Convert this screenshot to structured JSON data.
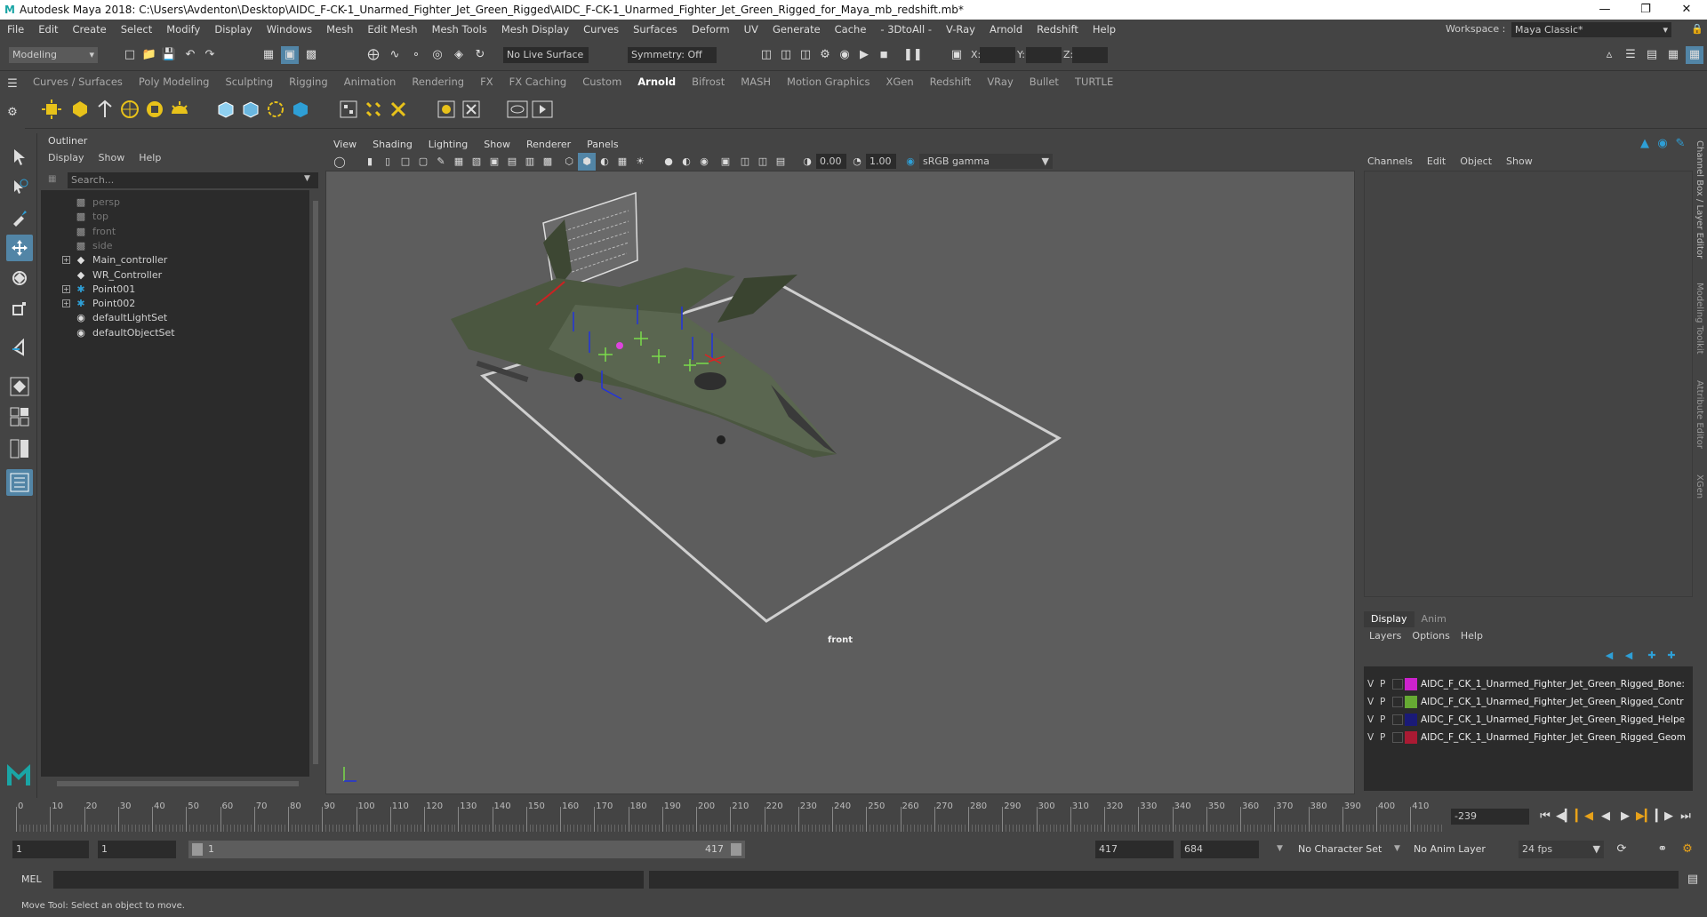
{
  "window": {
    "title": "Autodesk Maya 2018: C:\\Users\\Avdenton\\Desktop\\AIDC_F-CK-1_Unarmed_Fighter_Jet_Green_Rigged\\AIDC_F-CK-1_Unarmed_Fighter_Jet_Green_Rigged_for_Maya_mb_redshift.mb*"
  },
  "menubar": [
    "File",
    "Edit",
    "Create",
    "Select",
    "Modify",
    "Display",
    "Windows",
    "Mesh",
    "Edit Mesh",
    "Mesh Tools",
    "Mesh Display",
    "Curves",
    "Surfaces",
    "Deform",
    "UV",
    "Generate",
    "Cache",
    "- 3DtoAll -",
    "V-Ray",
    "Arnold",
    "Redshift",
    "Help"
  ],
  "workspace": {
    "label": "Workspace :",
    "value": "Maya Classic*"
  },
  "statusline": {
    "mode": "Modeling",
    "live_surface": "No Live Surface",
    "symmetry": "Symmetry: Off",
    "x_label": "X:",
    "y_label": "Y:",
    "z_label": "Z:"
  },
  "shelf_tabs": [
    "Curves / Surfaces",
    "Poly Modeling",
    "Sculpting",
    "Rigging",
    "Animation",
    "Rendering",
    "FX",
    "FX Caching",
    "Custom",
    "Arnold",
    "Bifrost",
    "MASH",
    "Motion Graphics",
    "XGen",
    "Redshift",
    "VRay",
    "Bullet",
    "TURTLE"
  ],
  "shelf_active": "Arnold",
  "outliner": {
    "title": "Outliner",
    "menu": [
      "Display",
      "Show",
      "Help"
    ],
    "search_placeholder": "Search...",
    "items": [
      {
        "label": "persp",
        "icon": "camera-icon",
        "dim": true,
        "expand": false
      },
      {
        "label": "top",
        "icon": "camera-icon",
        "dim": true,
        "expand": false
      },
      {
        "label": "front",
        "icon": "camera-icon",
        "dim": true,
        "expand": false
      },
      {
        "label": "side",
        "icon": "camera-icon",
        "dim": true,
        "expand": false
      },
      {
        "label": "Main_controller",
        "icon": "controller-icon",
        "dim": false,
        "expand": true
      },
      {
        "label": "WR_Controller",
        "icon": "controller-icon",
        "dim": false,
        "expand": false
      },
      {
        "label": "Point001",
        "icon": "locator-icon",
        "dim": false,
        "expand": true
      },
      {
        "label": "Point002",
        "icon": "locator-icon",
        "dim": false,
        "expand": true
      },
      {
        "label": "defaultLightSet",
        "icon": "set-icon",
        "dim": false,
        "expand": false
      },
      {
        "label": "defaultObjectSet",
        "icon": "set-icon",
        "dim": false,
        "expand": false
      }
    ]
  },
  "viewport": {
    "menu": [
      "View",
      "Shading",
      "Lighting",
      "Show",
      "Renderer",
      "Panels"
    ],
    "exposure": "0.00",
    "gamma": "1.00",
    "color_space": "sRGB gamma",
    "camera_label": "front"
  },
  "channelbox": {
    "menu": [
      "Channels",
      "Edit",
      "Object",
      "Show"
    ],
    "layer_tabs": [
      "Display",
      "Anim"
    ],
    "layer_menu": [
      "Layers",
      "Options",
      "Help"
    ],
    "layers": [
      {
        "v": "V",
        "p": "P",
        "color": "#cc22cc",
        "name": "AIDC_F_CK_1_Unarmed_Fighter_Jet_Green_Rigged_Bone:"
      },
      {
        "v": "V",
        "p": "P",
        "color": "#66aa33",
        "name": "AIDC_F_CK_1_Unarmed_Fighter_Jet_Green_Rigged_Contr"
      },
      {
        "v": "V",
        "p": "P",
        "color": "#1a1a77",
        "name": "AIDC_F_CK_1_Unarmed_Fighter_Jet_Green_Rigged_Helpe"
      },
      {
        "v": "V",
        "p": "P",
        "color": "#aa1a33",
        "name": "AIDC_F_CK_1_Unarmed_Fighter_Jet_Green_Rigged_Geom"
      }
    ]
  },
  "side_tabs": [
    "Channel Box / Layer Editor",
    "Modeling Toolkit",
    "Attribute Editor",
    "XGen"
  ],
  "timeline": {
    "ticks": [
      "0",
      "10",
      "20",
      "30",
      "40",
      "50",
      "60",
      "70",
      "80",
      "90",
      "100",
      "110",
      "120",
      "130",
      "140",
      "150",
      "160",
      "170",
      "180",
      "190",
      "200",
      "210",
      "220",
      "230",
      "240",
      "250",
      "260",
      "270",
      "280",
      "290",
      "300",
      "310",
      "320",
      "330",
      "340",
      "350",
      "360",
      "370",
      "380",
      "390",
      "400",
      "410"
    ],
    "current_frame": "-239"
  },
  "range": {
    "start": "1",
    "inner_start": "1",
    "slider_start": "1",
    "slider_end": "417",
    "end": "417",
    "outer_end": "684",
    "character_set": "No Character Set",
    "anim_layer": "No Anim Layer",
    "fps": "24 fps"
  },
  "cmd": {
    "label": "MEL"
  },
  "help_text": "Move Tool: Select an object to move."
}
